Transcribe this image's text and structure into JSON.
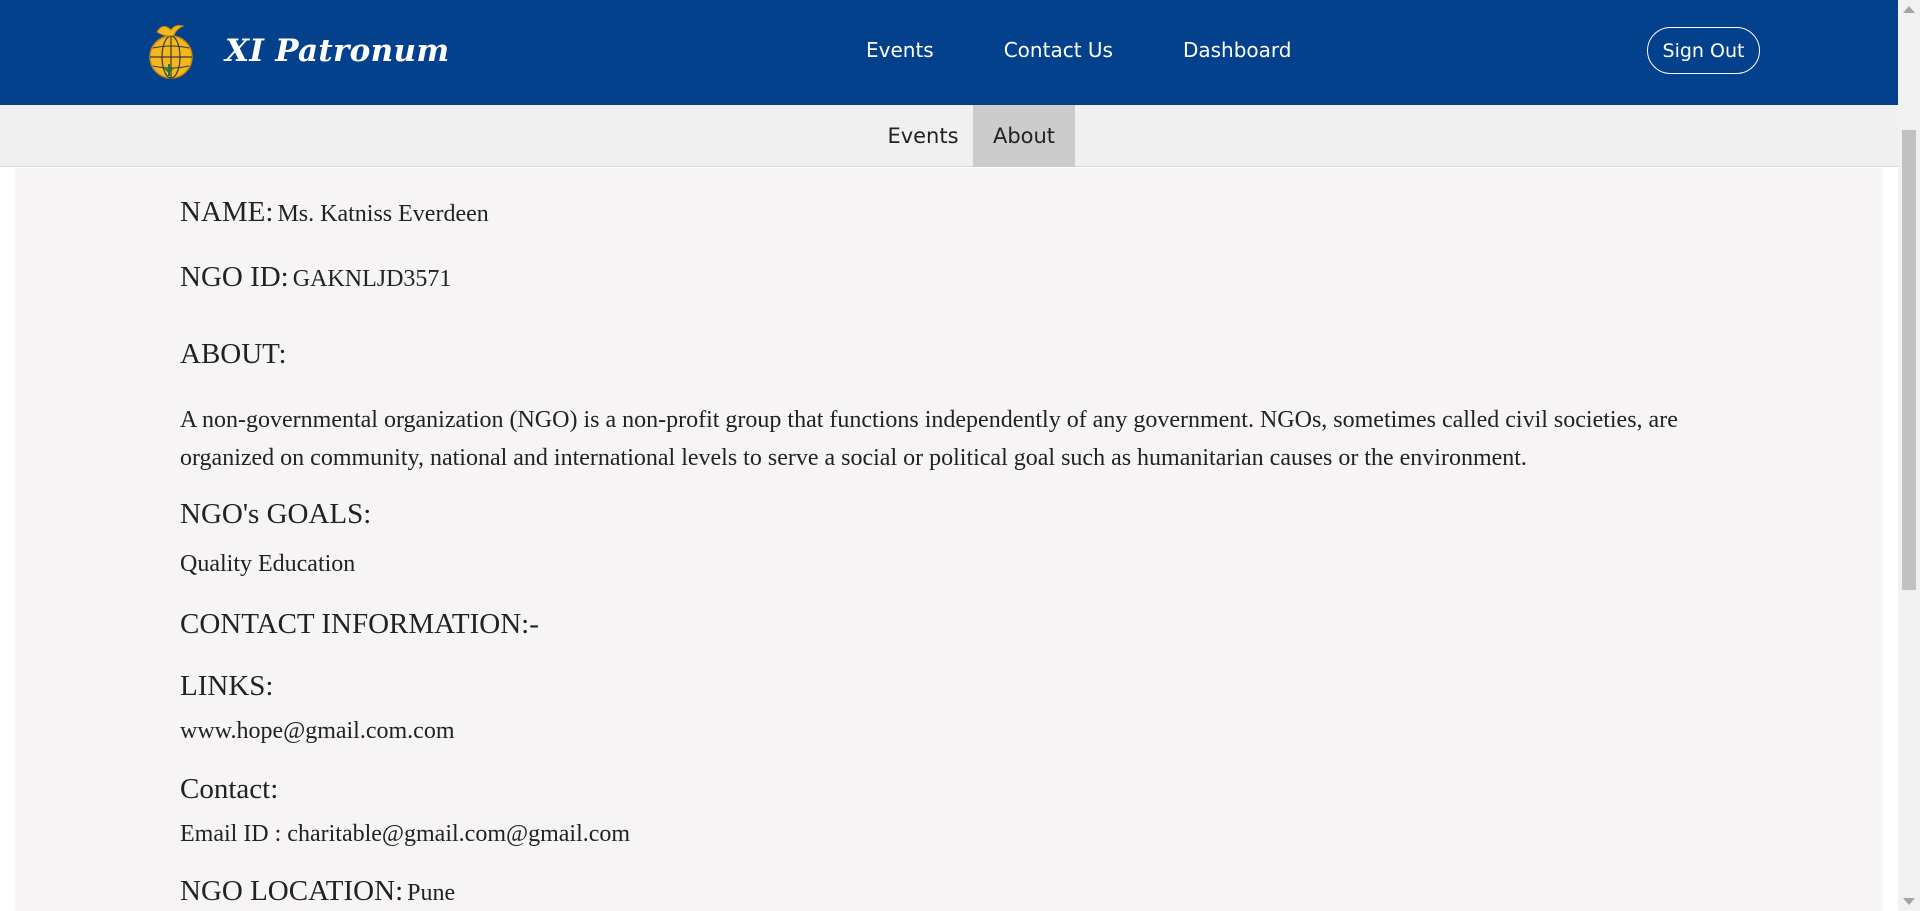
{
  "header": {
    "brand_name": "XI Patronum",
    "nav": [
      "Events",
      "Contact Us",
      "Dashboard"
    ],
    "signout_label": "Sign Out",
    "colors": {
      "navbar": "#04418c",
      "logo_gold": "#f4b71e"
    }
  },
  "subnav": {
    "tabs": [
      {
        "label": "Events",
        "active": false
      },
      {
        "label": "About",
        "active": true
      }
    ]
  },
  "profile": {
    "name_label": "NAME:",
    "name_value": "Ms. Katniss Everdeen",
    "ngo_id_label": "NGO ID:",
    "ngo_id_value": "GAKNLJD3571",
    "about_label": "ABOUT:",
    "about_text": "A non-governmental organization (NGO) is a non-profit group that functions independently of any government. NGOs, sometimes called civil societies, are organized on community, national and international levels to serve a social or political goal such as humanitarian causes or the environment.",
    "goals_label": "NGO's GOALS:",
    "goals_value": "Quality Education",
    "contact_info_label": "CONTACT INFORMATION:-",
    "links_label": "LINKS:",
    "links_value": "www.hope@gmail.com.com",
    "contact_label": "Contact:",
    "email_value": "Email ID : charitable@gmail.com@gmail.com",
    "location_label": "NGO LOCATION:",
    "location_value": "Pune"
  }
}
